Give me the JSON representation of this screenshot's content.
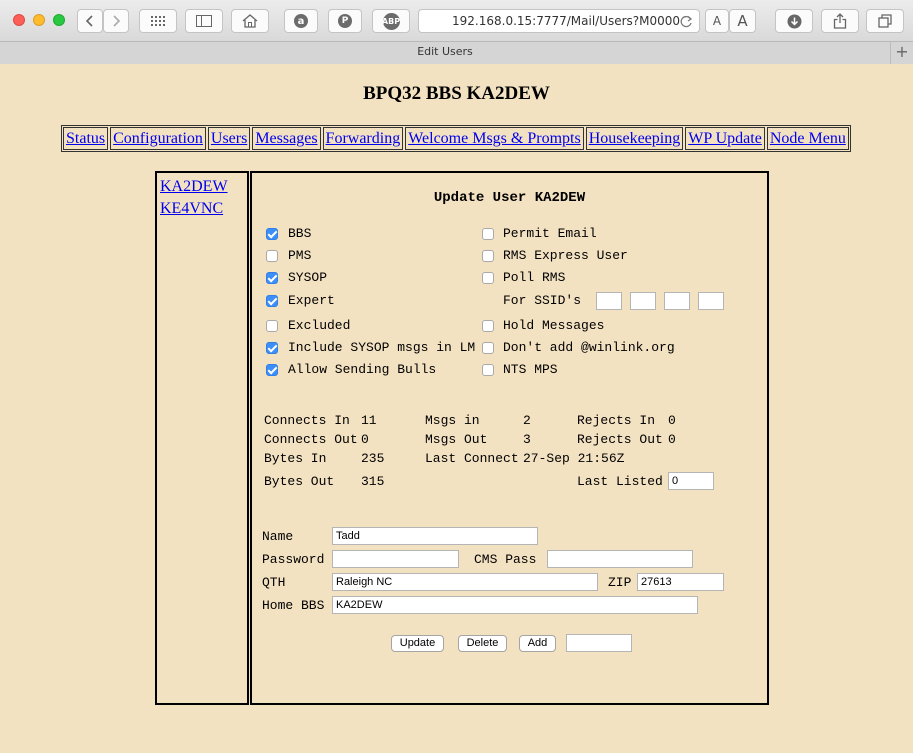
{
  "browser": {
    "url": "192.168.0.15:7777/Mail/Users?M0000",
    "tab_title": "Edit Users",
    "new_tab_symbol": "+",
    "font_small": "A",
    "font_large": "A",
    "adblock_badge": "ABP",
    "amazon_glyph": "a",
    "pinterest_glyph": "P",
    "icons": {
      "back": "chevron-left-icon",
      "forward": "chevron-right-icon",
      "reload": "reload-icon"
    }
  },
  "page": {
    "title": "BPQ32 BBS KA2DEW"
  },
  "nav": [
    "Status",
    "Configuration",
    "Users",
    "Messages",
    "Forwarding",
    "Welcome Msgs & Prompts",
    "Housekeeping",
    "WP Update",
    "Node Menu"
  ],
  "users": [
    "KA2DEW",
    "KE4VNC"
  ],
  "edit": {
    "title": "Update User KA2DEW",
    "left_flags": [
      {
        "label": "BBS",
        "checked": true
      },
      {
        "label": "PMS",
        "checked": false
      },
      {
        "label": "SYSOP",
        "checked": true
      },
      {
        "label": "Expert",
        "checked": true
      },
      {
        "label": "Excluded",
        "checked": false
      },
      {
        "label": "Include SYSOP msgs in LM",
        "checked": true
      },
      {
        "label": "Allow Sending Bulls",
        "checked": true
      }
    ],
    "right_flags": {
      "permit_email": {
        "label": "Permit Email",
        "checked": false
      },
      "rms_express": {
        "label": "RMS Express User",
        "checked": false
      },
      "poll_rms": {
        "label": "Poll RMS",
        "checked": false
      },
      "hold_messages": {
        "label": "Hold Messages",
        "checked": false
      },
      "dont_add": {
        "label": "Don't add @winlink.org",
        "checked": false
      },
      "nts_mps": {
        "label": "NTS MPS",
        "checked": false
      }
    },
    "ssid_label": "For SSID's",
    "ssid_values": [
      "",
      "",
      "",
      ""
    ],
    "stats": {
      "connects_in_label": "Connects In",
      "connects_in": "11",
      "connects_out_label": "Connects Out",
      "connects_out": "0",
      "bytes_in_label": "Bytes In",
      "bytes_in": "235",
      "bytes_out_label": "Bytes Out",
      "bytes_out": "315",
      "msgs_in_label": "Msgs in",
      "msgs_in": "2",
      "msgs_out_label": "Msgs Out",
      "msgs_out": "3",
      "last_connect_label": "Last Connect",
      "last_connect": "27-Sep 21:56Z",
      "rejects_in_label": "Rejects In",
      "rejects_in": "0",
      "rejects_out_label": "Rejects Out",
      "rejects_out": "0",
      "last_listed_label": "Last Listed",
      "last_listed": "0"
    },
    "fields": {
      "name_label": "Name",
      "name": "Tadd",
      "password_label": "Password",
      "password": "",
      "cms_pass_label": "CMS Pass",
      "cms_pass": "",
      "qth_label": "QTH",
      "qth": "Raleigh NC",
      "zip_label": "ZIP",
      "zip": "27613",
      "home_bbs_label": "Home BBS",
      "home_bbs": "KA2DEW"
    },
    "buttons": {
      "update": "Update",
      "delete": "Delete",
      "add": "Add",
      "add_value": ""
    }
  }
}
